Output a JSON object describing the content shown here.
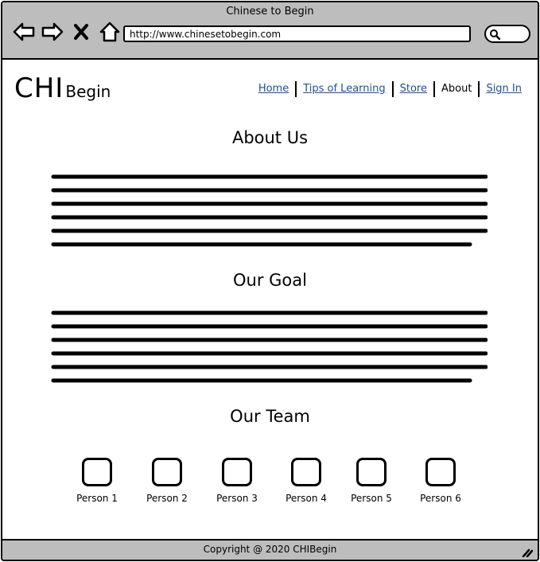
{
  "window": {
    "title": "Chinese to Begin"
  },
  "browser": {
    "url": "http://www.chinesetobegin.com",
    "icons": [
      "back-arrow-icon",
      "forward-arrow-icon",
      "close-x-icon",
      "home-icon",
      "search-icon"
    ]
  },
  "logo": {
    "big": "CHI",
    "small": "Begin"
  },
  "nav": {
    "items": [
      {
        "label": "Home",
        "link": true
      },
      {
        "label": "Tips of Learning",
        "link": true
      },
      {
        "label": "Store",
        "link": true
      },
      {
        "label": "About",
        "link": false
      },
      {
        "label": "Sign In",
        "link": true
      }
    ]
  },
  "sections": {
    "about_title": "About Us",
    "goal_title": "Our Goal",
    "team_title": "Our Team"
  },
  "team": {
    "members": [
      "Person 1",
      "Person 2",
      "Person 3",
      "Person 4",
      "Person 5",
      "Person 6"
    ]
  },
  "footer": {
    "copyright": "Copyright @ 2020 CHIBegin"
  },
  "colors": {
    "chrome": "#bdbdbd",
    "link": "#1f4f9c"
  }
}
